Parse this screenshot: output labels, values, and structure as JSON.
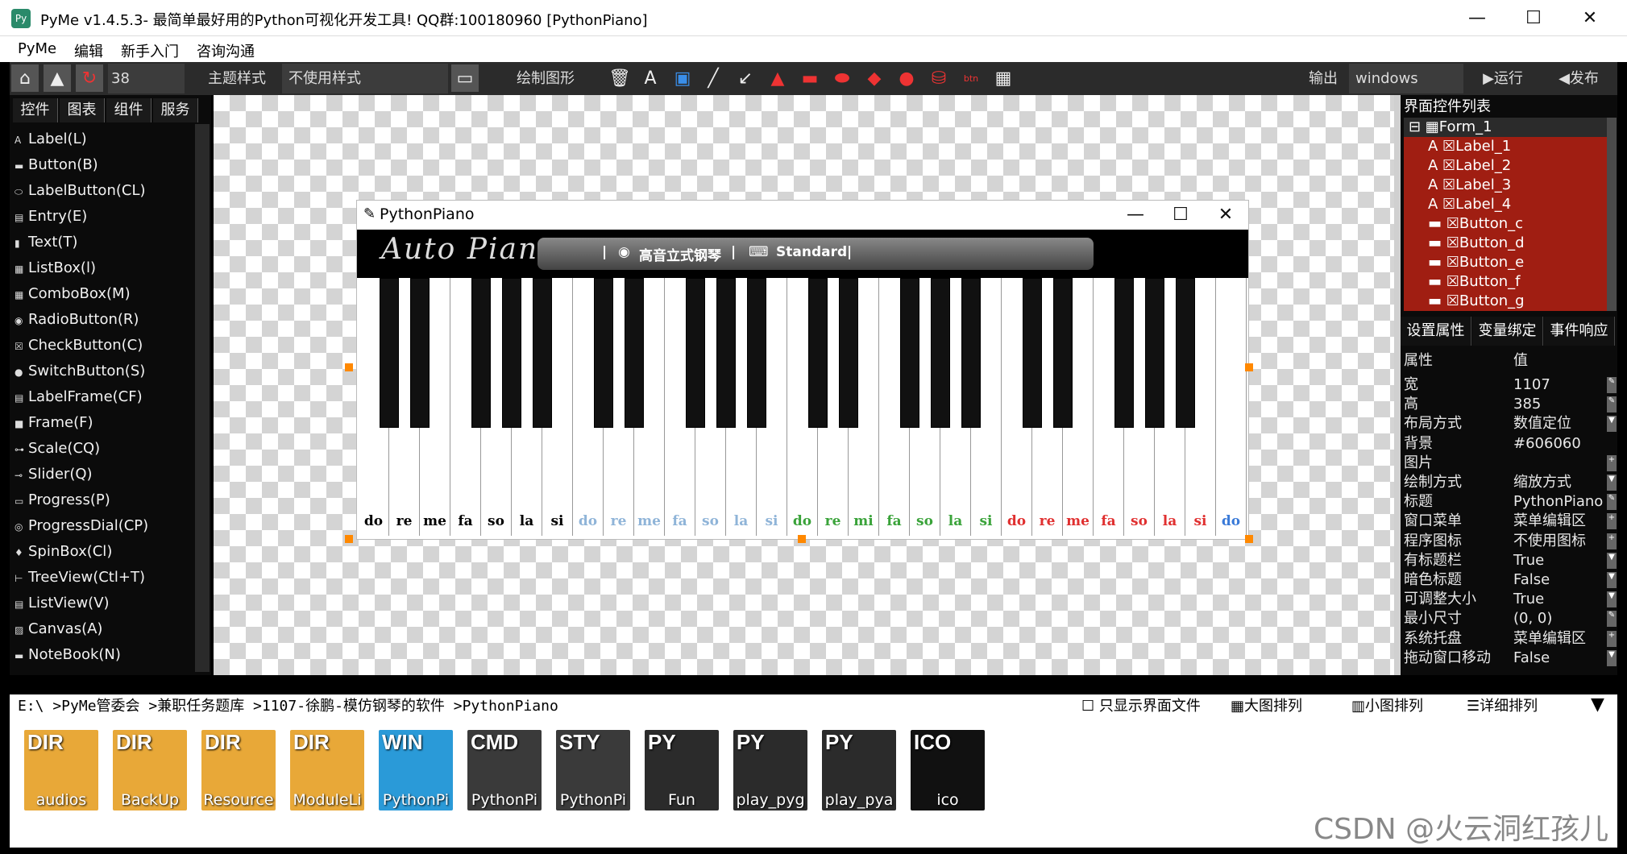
{
  "window": {
    "title": "PyMe v1.4.5.3- 最简单最好用的Python可视化开发工具! QQ群:100180960    [PythonPiano]",
    "minimize": "—",
    "maximize": "☐",
    "close": "✕"
  },
  "menu": [
    "PyMe",
    "编辑",
    "新手入门",
    "咨询沟通"
  ],
  "toolbar": {
    "font_size": "38",
    "theme_label": "主题样式",
    "theme_value": "不使用样式",
    "draw_label": "绘制图形",
    "output_label": "输出",
    "platform": "windows",
    "run": "▶运行",
    "publish": "◀发布"
  },
  "left_tabs": [
    "控件",
    "图表",
    "组件",
    "服务"
  ],
  "controls": [
    {
      "icon": "A",
      "label": "Label(L)"
    },
    {
      "icon": "▬",
      "label": "Button(B)"
    },
    {
      "icon": "⬭",
      "label": "LabelButton(CL)"
    },
    {
      "icon": "▤",
      "label": "Entry(E)"
    },
    {
      "icon": "▮",
      "label": "Text(T)"
    },
    {
      "icon": "▦",
      "label": "ListBox(l)"
    },
    {
      "icon": "▦",
      "label": "ComboBox(M)"
    },
    {
      "icon": "◉",
      "label": "RadioButton(R)"
    },
    {
      "icon": "☒",
      "label": "CheckButton(C)"
    },
    {
      "icon": "●",
      "label": "SwitchButton(S)"
    },
    {
      "icon": "▤",
      "label": "LabelFrame(CF)"
    },
    {
      "icon": "■",
      "label": "Frame(F)"
    },
    {
      "icon": "⊶",
      "label": "Scale(CQ)"
    },
    {
      "icon": "⊸",
      "label": "Slider(Q)"
    },
    {
      "icon": "▭",
      "label": "Progress(P)"
    },
    {
      "icon": "◎",
      "label": "ProgressDial(CP)"
    },
    {
      "icon": "♦",
      "label": "SpinBox(Cl)"
    },
    {
      "icon": "⊢",
      "label": "TreeView(Ctl+T)"
    },
    {
      "icon": "▤",
      "label": "ListView(V)"
    },
    {
      "icon": "▨",
      "label": "Canvas(A)"
    },
    {
      "icon": "▬",
      "label": "NoteBook(N)"
    }
  ],
  "form": {
    "title": "PythonPiano",
    "logo": "Auto Piano",
    "bar_sep": "|",
    "instrument": "高音立式钢琴",
    "mode": "Standard"
  },
  "notes": [
    {
      "n": "do",
      "c": "#000000"
    },
    {
      "n": "re",
      "c": "#000000"
    },
    {
      "n": "me",
      "c": "#000000"
    },
    {
      "n": "fa",
      "c": "#000000"
    },
    {
      "n": "so",
      "c": "#000000"
    },
    {
      "n": "la",
      "c": "#000000"
    },
    {
      "n": "si",
      "c": "#000000"
    },
    {
      "n": "do",
      "c": "#8fb4d8"
    },
    {
      "n": "re",
      "c": "#8fb4d8"
    },
    {
      "n": "me",
      "c": "#8fb4d8"
    },
    {
      "n": "fa",
      "c": "#8fb4d8"
    },
    {
      "n": "so",
      "c": "#8fb4d8"
    },
    {
      "n": "la",
      "c": "#8fb4d8"
    },
    {
      "n": "si",
      "c": "#8fb4d8"
    },
    {
      "n": "do",
      "c": "#3aa33a"
    },
    {
      "n": "re",
      "c": "#3aa33a"
    },
    {
      "n": "mi",
      "c": "#3aa33a"
    },
    {
      "n": "fa",
      "c": "#3aa33a"
    },
    {
      "n": "so",
      "c": "#3aa33a"
    },
    {
      "n": "la",
      "c": "#3aa33a"
    },
    {
      "n": "si",
      "c": "#3aa33a"
    },
    {
      "n": "do",
      "c": "#e03030"
    },
    {
      "n": "re",
      "c": "#e03030"
    },
    {
      "n": "me",
      "c": "#e03030"
    },
    {
      "n": "fa",
      "c": "#e03030"
    },
    {
      "n": "so",
      "c": "#e03030"
    },
    {
      "n": "la",
      "c": "#e03030"
    },
    {
      "n": "si",
      "c": "#e03030"
    },
    {
      "n": "do",
      "c": "#3a7ad8"
    }
  ],
  "right": {
    "header": "界面控件列表",
    "tree": [
      {
        "label": "⊟ ▦Form_1",
        "sel": false,
        "indent": 0
      },
      {
        "label": "A ☒Label_1",
        "sel": true,
        "indent": 1
      },
      {
        "label": "A ☒Label_2",
        "sel": true,
        "indent": 1
      },
      {
        "label": "A ☒Label_3",
        "sel": true,
        "indent": 1
      },
      {
        "label": "A ☒Label_4",
        "sel": true,
        "indent": 1
      },
      {
        "label": "▬ ☒Button_c",
        "sel": true,
        "indent": 1
      },
      {
        "label": "▬ ☒Button_d",
        "sel": true,
        "indent": 1
      },
      {
        "label": "▬ ☒Button_e",
        "sel": true,
        "indent": 1
      },
      {
        "label": "▬ ☒Button_f",
        "sel": true,
        "indent": 1
      },
      {
        "label": "▬ ☒Button_g",
        "sel": true,
        "indent": 1
      }
    ],
    "tabs": [
      "设置属性",
      "变量绑定",
      "事件响应"
    ],
    "prop_header_key": "属性",
    "prop_header_val": "值",
    "props": [
      {
        "k": "宽",
        "v": "1107",
        "b": "✎"
      },
      {
        "k": "高",
        "v": "385",
        "b": "✎"
      },
      {
        "k": "布局方式",
        "v": "数值定位",
        "b": "▼"
      },
      {
        "k": "背景",
        "v": "#606060",
        "b": ""
      },
      {
        "k": "图片",
        "v": "",
        "b": "+"
      },
      {
        "k": "绘制方式",
        "v": "缩放方式",
        "b": "▼"
      },
      {
        "k": "标题",
        "v": "PythonPiano",
        "b": "✎"
      },
      {
        "k": "窗口菜单",
        "v": "菜单编辑区",
        "b": "+"
      },
      {
        "k": "程序图标",
        "v": "不使用图标",
        "b": "+"
      },
      {
        "k": "有标题栏",
        "v": "True",
        "b": "▼"
      },
      {
        "k": "暗色标题",
        "v": "False",
        "b": "▼"
      },
      {
        "k": "可调整大小",
        "v": "True",
        "b": "▼"
      },
      {
        "k": "最小尺寸",
        "v": "(0, 0)",
        "b": "✎"
      },
      {
        "k": "系统托盘",
        "v": "菜单编辑区",
        "b": "+"
      },
      {
        "k": "拖动窗口移动",
        "v": "False",
        "b": "▼"
      }
    ]
  },
  "path": {
    "text": "E:\\ >PyMe管委会 >兼职任务题库 >1107-徐鹏-模仿钢琴的软件 >PythonPiano",
    "only_ui": "☐ 只显示界面文件",
    "big": "▦大图排列",
    "small": "▥小图排列",
    "detail": "☰详细排列"
  },
  "files": [
    {
      "tag": "DIR",
      "label": "audios",
      "color": "#e8a838"
    },
    {
      "tag": "DIR",
      "label": "BackUp",
      "color": "#e8a838"
    },
    {
      "tag": "DIR",
      "label": "Resource",
      "color": "#e8a838"
    },
    {
      "tag": "DIR",
      "label": "ModuleLi",
      "color": "#e8a838"
    },
    {
      "tag": "WIN",
      "label": "PythonPi",
      "color": "#2a9ad8"
    },
    {
      "tag": "CMD",
      "label": "PythonPi",
      "color": "#3a3a3a"
    },
    {
      "tag": "STY",
      "label": "PythonPi",
      "color": "#3a3a3a"
    },
    {
      "tag": "PY",
      "label": "Fun",
      "color": "#2b2b2b"
    },
    {
      "tag": "PY",
      "label": "play_pyg",
      "color": "#2b2b2b"
    },
    {
      "tag": "PY",
      "label": "play_pya",
      "color": "#2b2b2b"
    },
    {
      "tag": "ICO",
      "label": "ico",
      "color": "#111111"
    }
  ],
  "watermark": "CSDN @火云洞红孩儿"
}
